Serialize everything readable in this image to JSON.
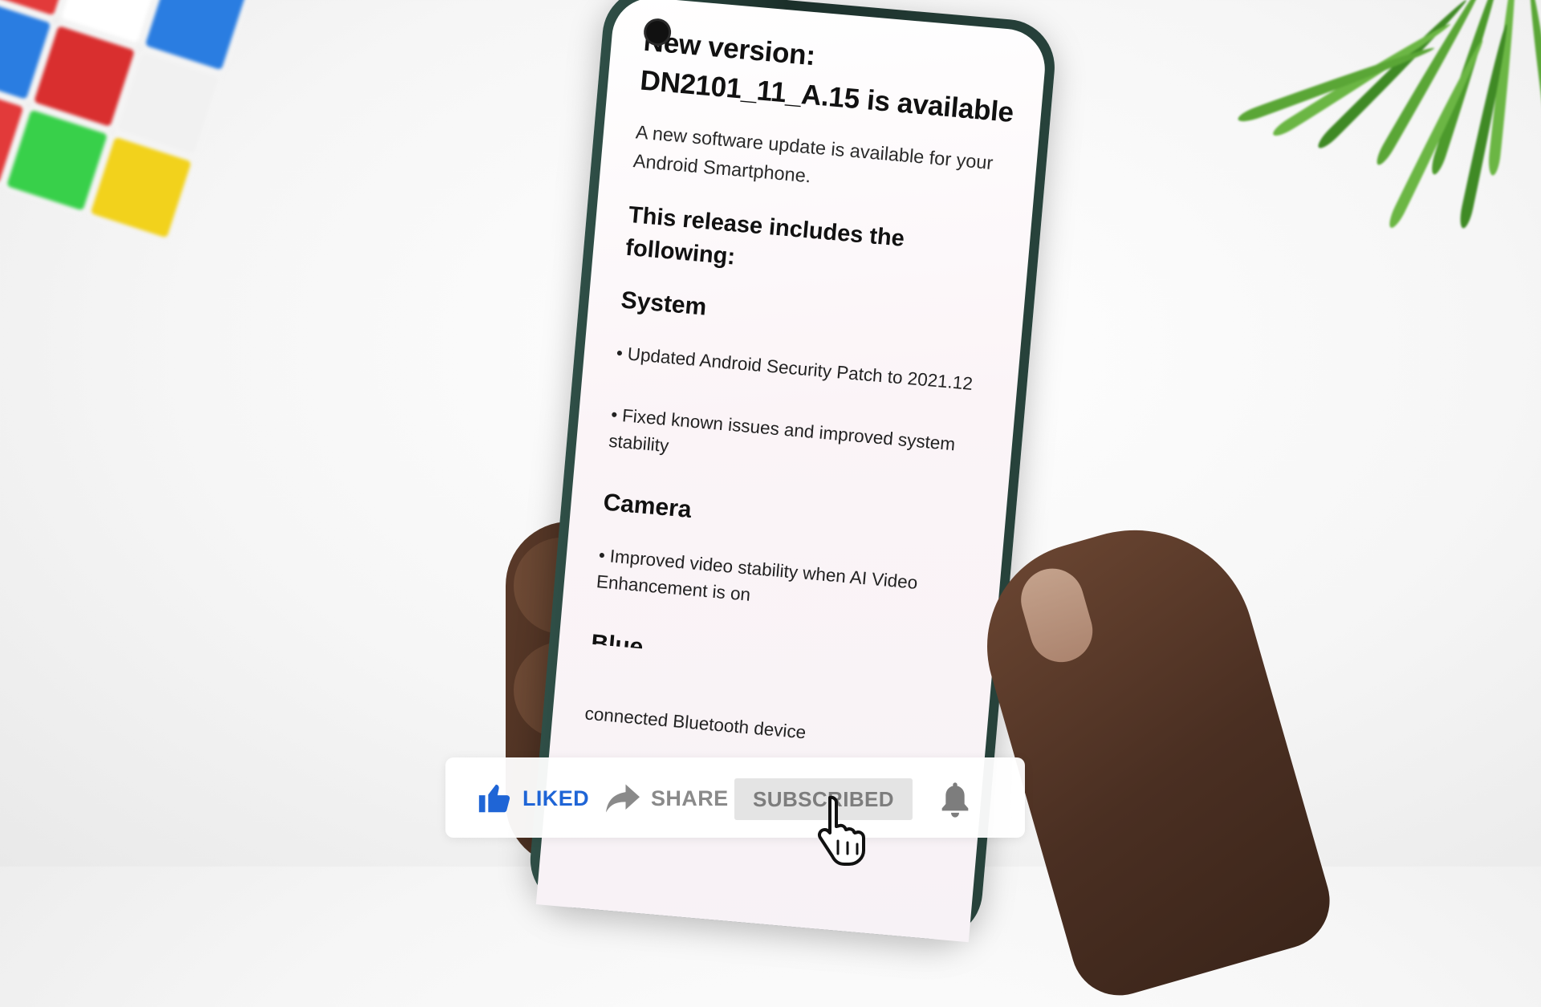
{
  "screen": {
    "title": "New version: DN2101_11_A.15 is available",
    "description": "A new software update is available for your Android Smartphone.",
    "release_heading": "This release includes the following:",
    "sections": [
      {
        "name": "System",
        "items": [
          "Updated Android Security Patch to 2021.12",
          "Fixed known issues and improved system stability"
        ]
      },
      {
        "name": "Camera",
        "items": [
          "Improved video stability when AI Video Enhancement is on"
        ]
      }
    ],
    "next_section_partial": "Blue",
    "bottom_partial_text": "connected Bluetooth device"
  },
  "overlay": {
    "like_label": "LIKED",
    "share_label": "SHARE",
    "subscribe_label": "SUBSCRIBED",
    "like_color": "#1f65d6",
    "inactive_color": "#8a8a8a",
    "icons": {
      "like": "thumbs-up-icon",
      "share": "share-arrow-icon",
      "bell": "bell-icon",
      "cursor": "hand-pointer-icon"
    }
  }
}
